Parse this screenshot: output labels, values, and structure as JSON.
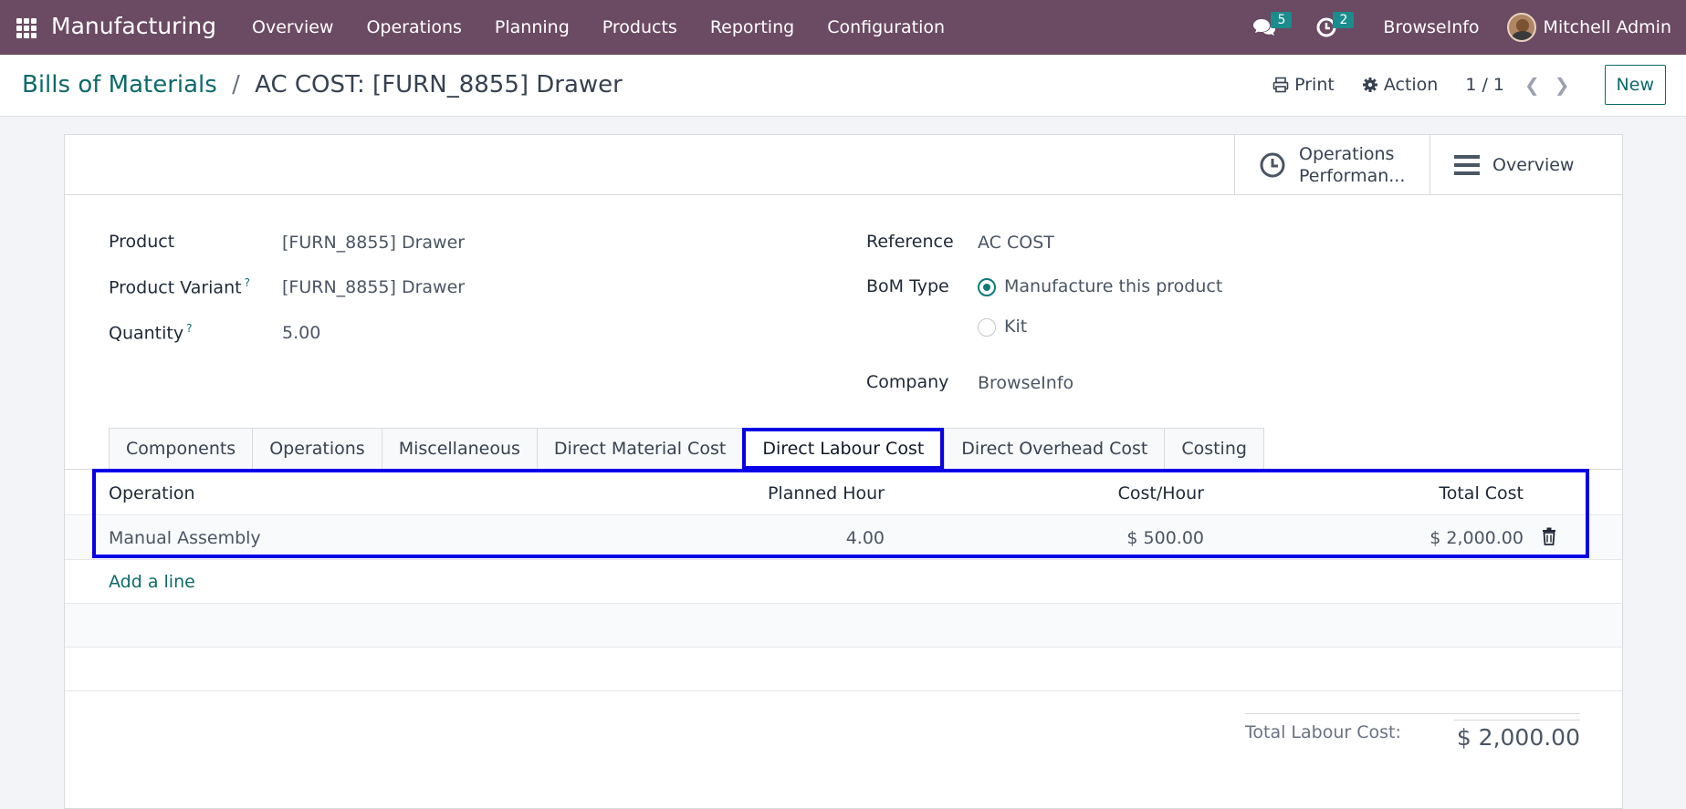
{
  "navbar": {
    "app_title": "Manufacturing",
    "menu": [
      "Overview",
      "Operations",
      "Planning",
      "Products",
      "Reporting",
      "Configuration"
    ],
    "messages_count": "5",
    "activities_count": "2",
    "company": "BrowseInfo",
    "user": "Mitchell Admin",
    "color": "#6b4a63"
  },
  "control": {
    "breadcrumb_parent": "Bills of Materials",
    "breadcrumb_sep": "/",
    "breadcrumb_current": "AC COST: [FURN_8855] Drawer",
    "print_label": "Print",
    "action_label": "Action",
    "pager": "1 / 1",
    "new_label": "New"
  },
  "smart_buttons": {
    "operations_line1": "Operations",
    "operations_line2": "Performan...",
    "overview": "Overview"
  },
  "form": {
    "product_label": "Product",
    "product_value": "[FURN_8855] Drawer",
    "variant_label": "Product Variant",
    "variant_value": "[FURN_8855] Drawer",
    "quantity_label": "Quantity",
    "quantity_value": "5.00",
    "help_mark": "?",
    "reference_label": "Reference",
    "reference_value": "AC COST",
    "bom_type_label": "BoM Type",
    "bom_type_options": [
      "Manufacture this product",
      "Kit"
    ],
    "bom_type_selected": "Manufacture this product",
    "company_label": "Company",
    "company_value": "BrowseInfo"
  },
  "tabs": [
    "Components",
    "Operations",
    "Miscellaneous",
    "Direct Material Cost",
    "Direct Labour Cost",
    "Direct Overhead Cost",
    "Costing"
  ],
  "active_tab": "Direct Labour Cost",
  "labour_table": {
    "columns": [
      "Operation",
      "Planned Hour",
      "Cost/Hour",
      "Total Cost"
    ],
    "rows": [
      {
        "operation": "Manual Assembly",
        "planned_hour": "4.00",
        "cost_hour": "$ 500.00",
        "total_cost": "$ 2,000.00"
      }
    ],
    "add_line": "Add a line"
  },
  "totals": {
    "label": "Total Labour Cost:",
    "value": "$ 2,000.00"
  },
  "highlight_color": "#0a00e6",
  "accent_color": "#0f6a6a"
}
